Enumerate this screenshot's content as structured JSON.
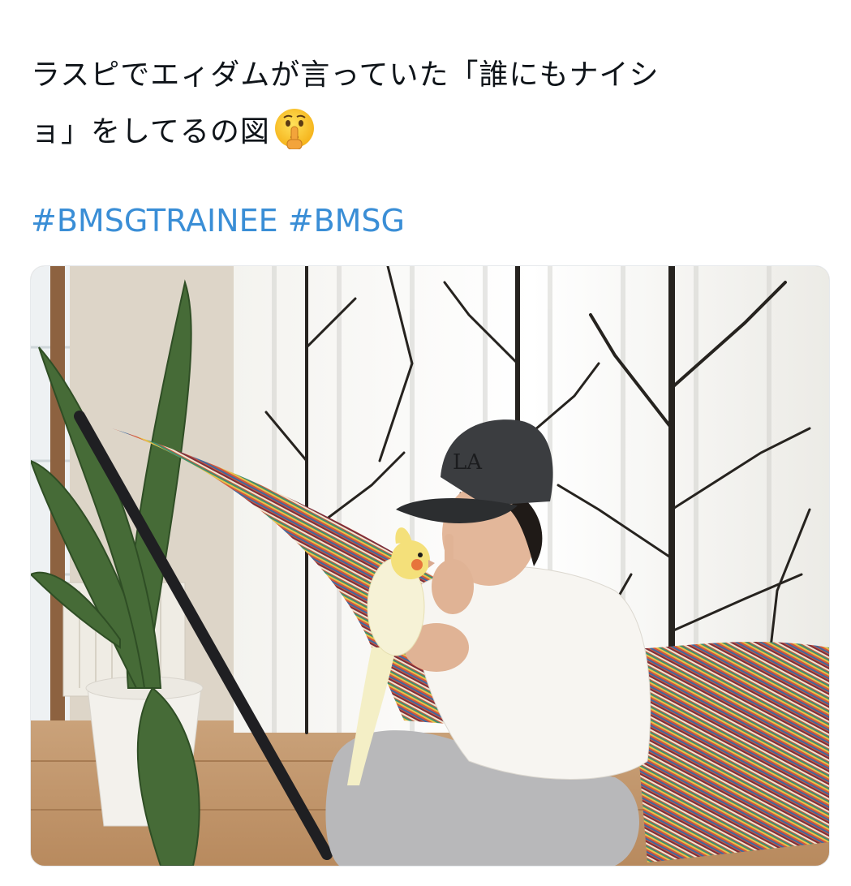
{
  "tweet": {
    "text_line1": "ラスピでエィダムが言っていた「誰にもナイシ",
    "text_line2": "ョ」をしてるの図",
    "emoji": "shushing-face-emoji",
    "hashtags": [
      "#BMSGTRAINEE",
      "#BMSG"
    ]
  },
  "media": {
    "kind": "photo",
    "subject": "photo"
  },
  "colors": {
    "text": "#0f1419",
    "link": "#3a8ed6",
    "background": "#ffffff"
  }
}
